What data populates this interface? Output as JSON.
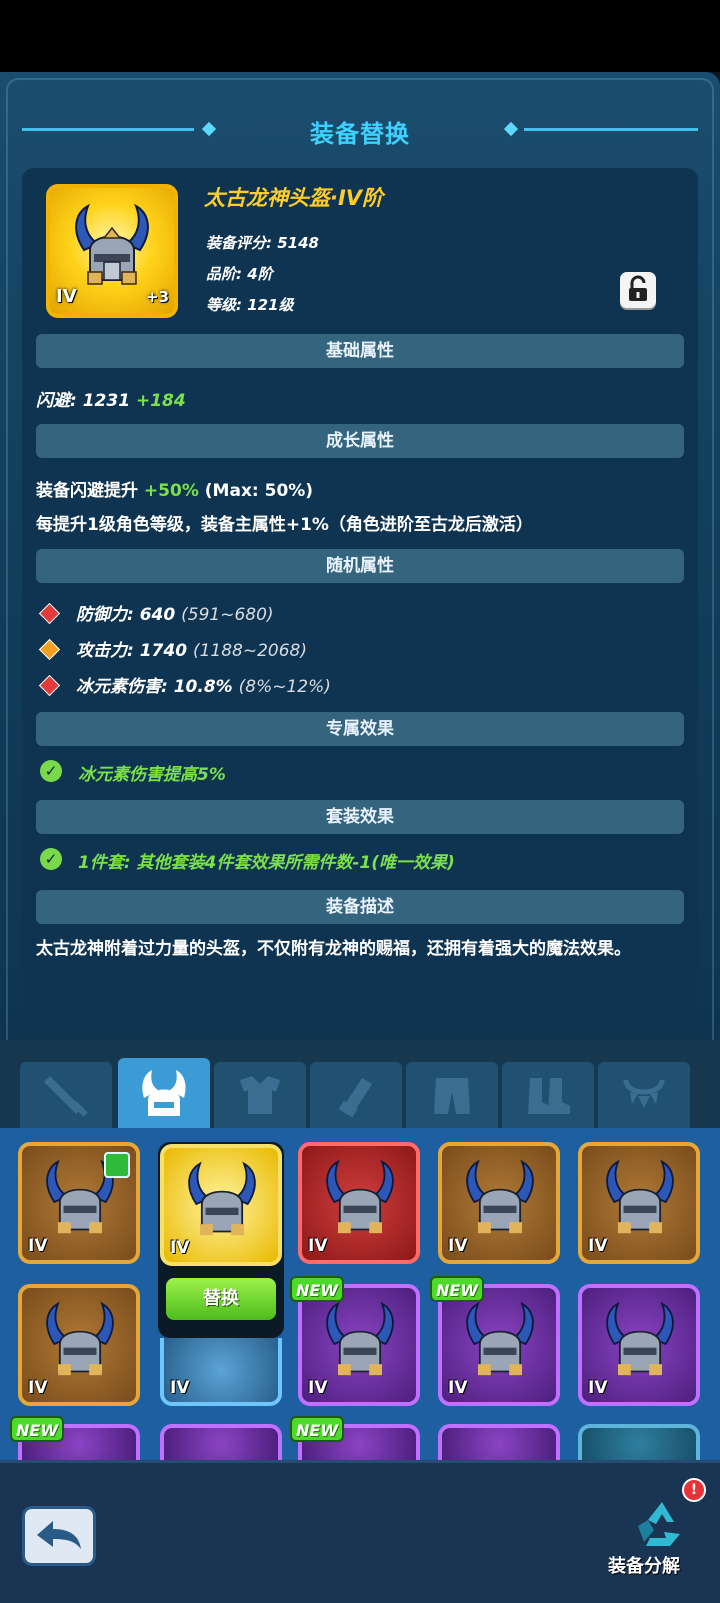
{
  "header": {
    "title": "装备替换"
  },
  "item": {
    "name": "太古龙神头盔·IV阶",
    "score": "装备评分: 5148",
    "grade": "品阶: 4阶",
    "level": "等级: 121级",
    "tier_label": "IV",
    "plus_label": "+3"
  },
  "sections": {
    "basic": "基础属性",
    "growth": "成长属性",
    "random": "随机属性",
    "exclusive": "专属效果",
    "set": "套装效果",
    "desc": "装备描述"
  },
  "basic_attr": {
    "label": "闪避: 1231",
    "bonus": "+184"
  },
  "growth_attr": {
    "line1_prefix": "装备闪避提升",
    "line1_value": "+50%",
    "line1_suffix": "(Max: 50%)",
    "line2": "每提升1级角色等级，装备主属性+1%（角色进阶至古龙后激活）"
  },
  "random_attrs": [
    {
      "label": "防御力: 640",
      "range": "(591~680)",
      "gem_color": "#e33b3b"
    },
    {
      "label": "攻击力: 1740",
      "range": "(1188~2068)",
      "gem_color": "#f0a21e"
    },
    {
      "label": "冰元素伤害: 10.8%",
      "range": "(8%~12%)",
      "gem_color": "#e33b3b"
    }
  ],
  "exclusive_effect": "冰元素伤害提高5%",
  "set_effect": "1件套: 其他套装4件套效果所需件数-1(唯一效果)",
  "description": "太古龙神附着过力量的头盔，不仅附有龙神的赐福，还拥有着强大的魔法效果。",
  "tabs": [
    "weapon",
    "helmet",
    "armor",
    "bracer",
    "pants",
    "boots",
    "necklace"
  ],
  "grid": {
    "tier": "IV",
    "new_label": "NEW",
    "replace_label": "替换"
  },
  "bottom": {
    "recycle_label": "装备分解",
    "alert": "!"
  },
  "colors": {
    "accent": "#3ed1ff",
    "gold": "#ffcc2a",
    "green": "#7be04a"
  }
}
